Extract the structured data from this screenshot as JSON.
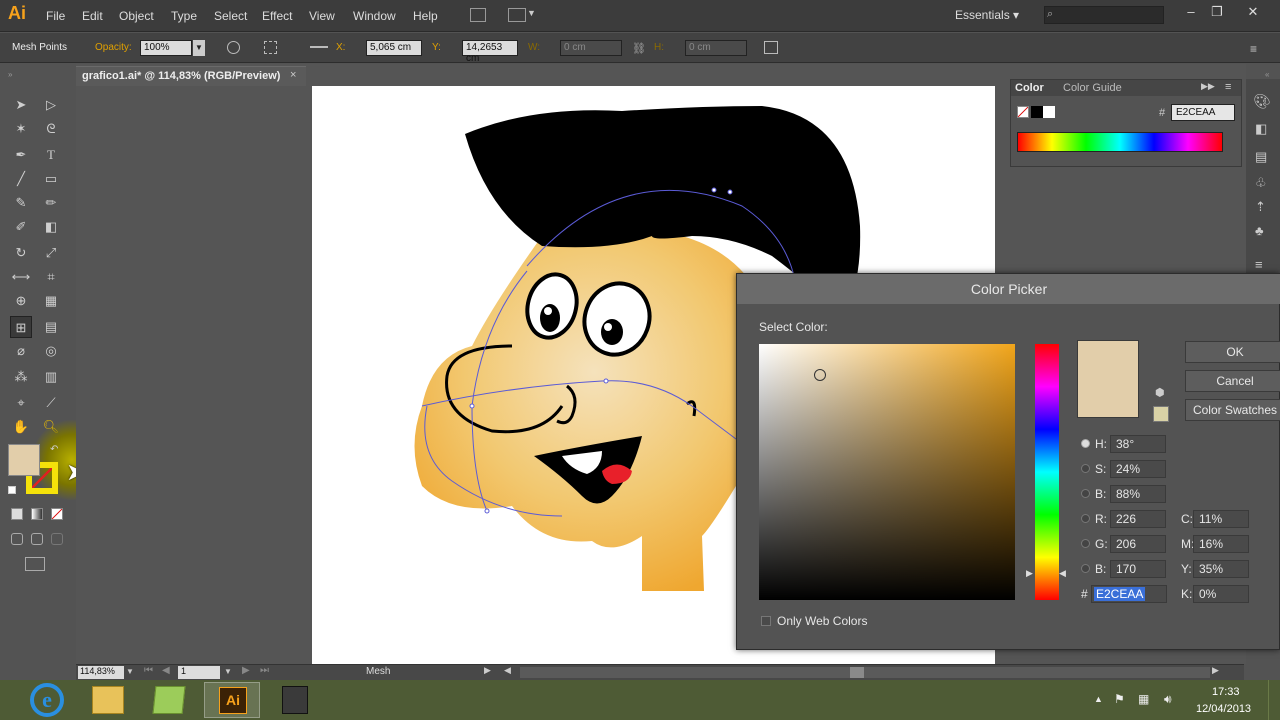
{
  "app": {
    "logo": "Ai"
  },
  "menu": [
    "File",
    "Edit",
    "Object",
    "Type",
    "Select",
    "Effect",
    "View",
    "Window",
    "Help"
  ],
  "workspace": "Essentials",
  "control_bar": {
    "selection_type": "Mesh Points",
    "opacity_label": "Opacity:",
    "opacity_value": "100%",
    "x_label": "X:",
    "x_value": "5,065 cm",
    "y_label": "Y:",
    "y_value": "14,2653 cm",
    "w_label": "W:",
    "w_value": "0 cm",
    "h_label": "H:",
    "h_value": "0 cm"
  },
  "document_tab": {
    "title": "grafico1.ai* @ 114,83% (RGB/Preview)",
    "close": "×"
  },
  "color_panel": {
    "tab_color": "Color",
    "tab_guide": "Color Guide",
    "hash": "#",
    "hex_value": "E2CEAA"
  },
  "color_picker": {
    "title": "Color Picker",
    "select_label": "Select Color:",
    "ok": "OK",
    "cancel": "Cancel",
    "swatches": "Color Swatches",
    "only_web": "Only Web Colors",
    "h_label": "H:",
    "h_value": "38°",
    "s_label": "S:",
    "s_value": "24%",
    "b_label": "B:",
    "b_value": "88%",
    "r_label": "R:",
    "r_value": "226",
    "g_label": "G:",
    "g_value": "206",
    "b2_label": "B:",
    "b2_value": "170",
    "hex_label": "#",
    "hex_value": "E2CEAA",
    "c_label": "C:",
    "c_value": "11%",
    "m_label": "M:",
    "m_value": "16%",
    "y_label": "Y:",
    "y_value": "35%",
    "k_label": "K:",
    "k_value": "0%",
    "selected_color": "#E2CEAA",
    "hue_color": "#F1A51A"
  },
  "status_bar": {
    "zoom": "114,83%",
    "page": "1",
    "tool": "Mesh"
  },
  "taskbar": {
    "time": "17:33",
    "date": "12/04/2013"
  },
  "colors": {
    "fill": "#E2CEAA",
    "stroke": "#F5E20A",
    "skin": "#F2B84A",
    "tongue": "#E8202A",
    "hair": "#000000"
  }
}
